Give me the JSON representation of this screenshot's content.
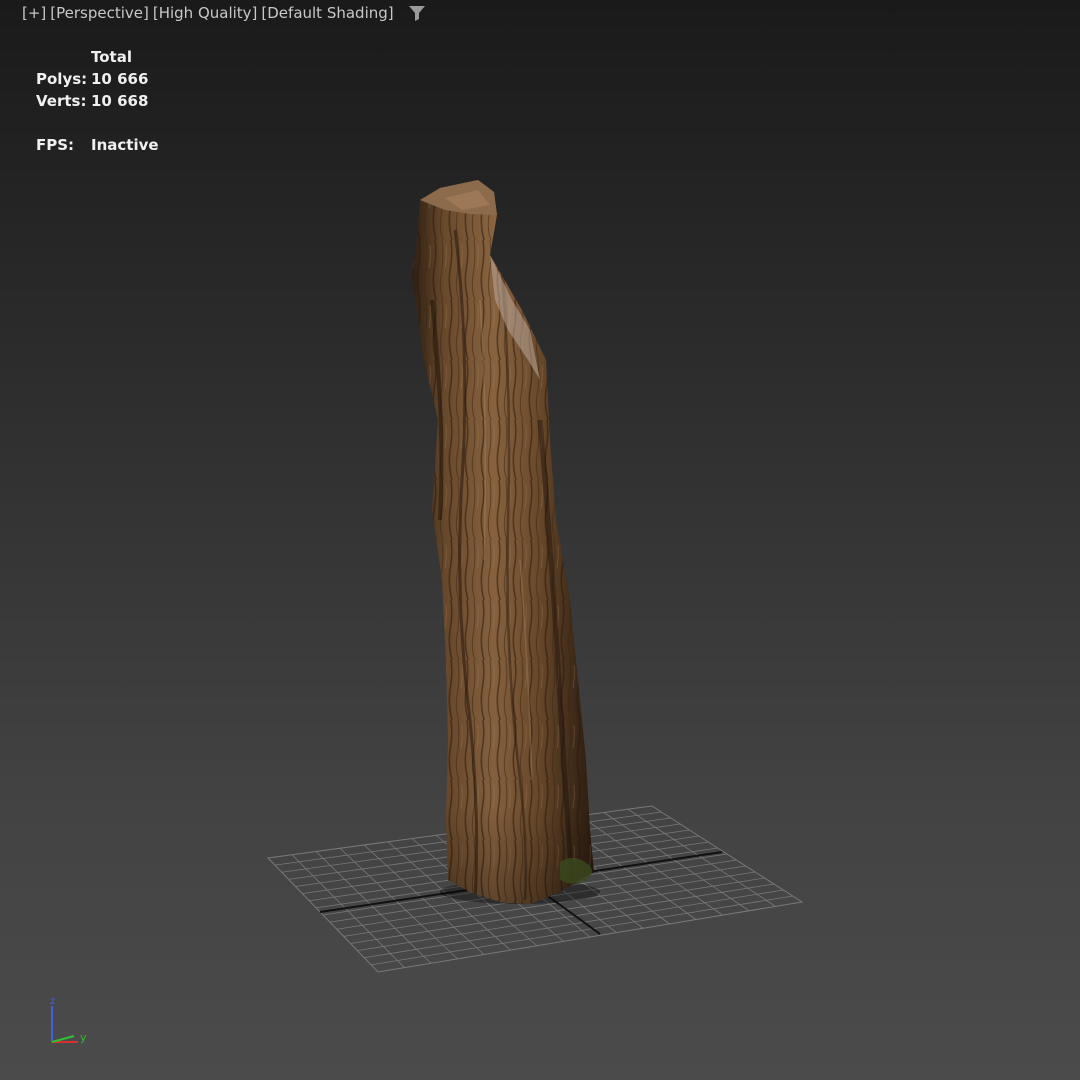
{
  "viewport": {
    "menus": {
      "general": "[+]",
      "point_of_view": "[Perspective]",
      "quality": "[High Quality]",
      "shading": "[Default Shading]"
    },
    "filter_icon": "funnel-icon"
  },
  "stats": {
    "header": "Total",
    "polys_label": "Polys:",
    "polys_value": "10 666",
    "verts_label": "Verts:",
    "verts_value": "10 668",
    "fps_label": "FPS:",
    "fps_value": "Inactive"
  },
  "scene": {
    "object": "tree-trunk-model",
    "ground": "home-grid",
    "background_top": "#1a1a1a",
    "background_bottom": "#4b4b4b",
    "bark_color": "#6b4a2e",
    "grid_color": "#8a8a8a"
  },
  "gizmo": {
    "z_label": "z",
    "y_label": "y",
    "x_color": "#d83030",
    "y_color": "#30c030",
    "z_color": "#4060e0"
  }
}
